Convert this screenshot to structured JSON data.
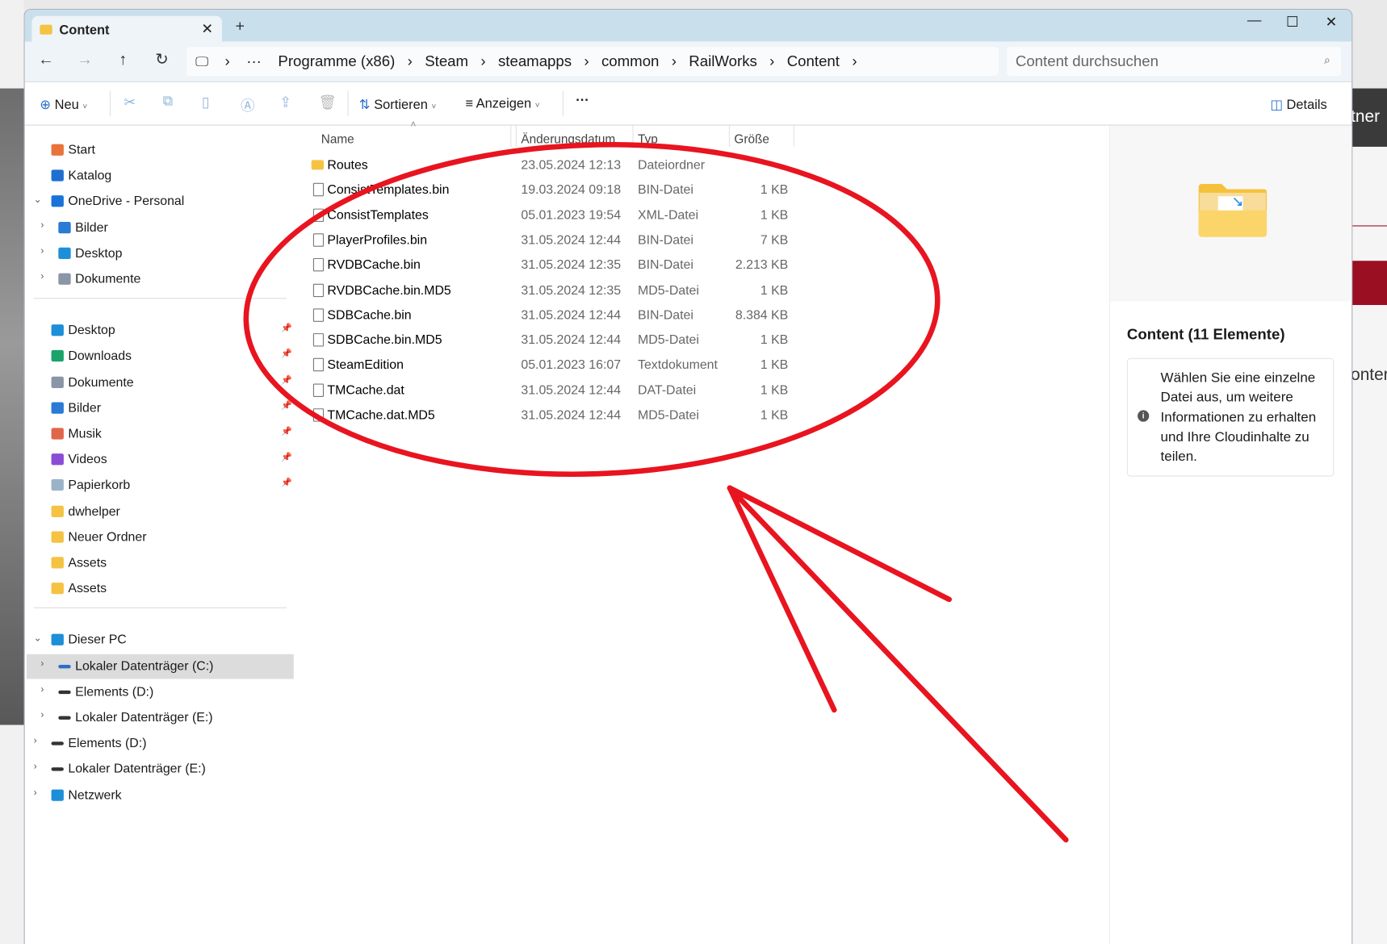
{
  "window": {
    "tab_title": "Content",
    "close_tab": "✕",
    "new_tab": "+",
    "minimize": "—",
    "maximize": "☐",
    "close": "✕"
  },
  "nav": {
    "back": "←",
    "forward": "→",
    "up": "↑",
    "refresh": "↻",
    "pc": "🖵",
    "more": "···",
    "sep": "›",
    "breadcrumbs": [
      "Programme (x86)",
      "Steam",
      "steamapps",
      "common",
      "RailWorks",
      "Content"
    ],
    "search_placeholder": "Content durchsuchen"
  },
  "toolbar": {
    "new": "Neu",
    "sort": "Sortieren",
    "view": "Anzeigen",
    "more": "···",
    "details": "Details"
  },
  "sidebar": {
    "items": [
      {
        "label": "Start",
        "icon": "home-icon",
        "color": "#e8743b",
        "level": 1
      },
      {
        "label": "Katalog",
        "icon": "gallery-icon",
        "color": "#1f6fd1",
        "level": 1
      },
      {
        "label": "OneDrive - Personal",
        "icon": "cloud-icon",
        "color": "#1a73d9",
        "level": 1,
        "chevron": "open"
      },
      {
        "label": "Bilder",
        "icon": "pictures-icon",
        "color": "#2a7ad6",
        "level": 2,
        "chevron": "closed"
      },
      {
        "label": "Desktop",
        "icon": "desktop-icon",
        "color": "#1d8fd8",
        "level": 2,
        "chevron": "closed"
      },
      {
        "label": "Dokumente",
        "icon": "documents-icon",
        "color": "#8a96a6",
        "level": 2,
        "chevron": "closed"
      },
      {
        "sep": true
      },
      {
        "label": "Desktop",
        "icon": "desktop-icon",
        "color": "#1d8fd8",
        "level": 1,
        "pin": true
      },
      {
        "label": "Downloads",
        "icon": "download-icon",
        "color": "#1aa36b",
        "level": 1,
        "pin": true
      },
      {
        "label": "Dokumente",
        "icon": "documents-icon",
        "color": "#8a96a6",
        "level": 1,
        "pin": true
      },
      {
        "label": "Bilder",
        "icon": "pictures-icon",
        "color": "#2a7ad6",
        "level": 1,
        "pin": true
      },
      {
        "label": "Musik",
        "icon": "music-icon",
        "color": "#e0664a",
        "level": 1,
        "pin": true
      },
      {
        "label": "Videos",
        "icon": "videos-icon",
        "color": "#8a4dd6",
        "level": 1,
        "pin": true
      },
      {
        "label": "Papierkorb",
        "icon": "recycle-bin-icon",
        "color": "#9bb3c9",
        "level": 1,
        "pin": true
      },
      {
        "label": "dwhelper",
        "icon": "folder-icon",
        "color": "#f5c242",
        "level": 1
      },
      {
        "label": "Neuer Ordner",
        "icon": "folder-icon",
        "color": "#f5c242",
        "level": 1
      },
      {
        "label": "Assets",
        "icon": "folder-icon",
        "color": "#f5c242",
        "level": 1
      },
      {
        "label": "Assets",
        "icon": "folder-icon",
        "color": "#f5c242",
        "level": 1
      },
      {
        "sep": true
      },
      {
        "label": "Dieser PC",
        "icon": "pc-icon",
        "color": "#1d8fd8",
        "level": 1,
        "chevron": "open"
      },
      {
        "label": "Lokaler Datenträger (C:)",
        "icon": "drive-icon",
        "color": "#2a6fc9",
        "level": 2,
        "chevron": "closed",
        "selected": true
      },
      {
        "label": "Elements (D:)",
        "icon": "drive-icon",
        "color": "#333",
        "level": 2,
        "chevron": "closed"
      },
      {
        "label": "Lokaler Datenträger (E:)",
        "icon": "drive-icon",
        "color": "#333",
        "level": 2,
        "chevron": "closed"
      },
      {
        "label": "Elements (D:)",
        "icon": "drive-icon",
        "color": "#333",
        "level": 1,
        "chevron": "closed"
      },
      {
        "label": "Lokaler Datenträger (E:)",
        "icon": "drive-icon",
        "color": "#333",
        "level": 1,
        "chevron": "closed"
      },
      {
        "label": "Netzwerk",
        "icon": "network-icon",
        "color": "#1d8fd8",
        "level": 1,
        "chevron": "closed"
      }
    ]
  },
  "list": {
    "columns": [
      "Name",
      "Änderungsdatum",
      "Typ",
      "Größe"
    ],
    "rows": [
      {
        "name": "Routes",
        "date": "23.05.2024 12:13",
        "type": "Dateiordner",
        "size": "",
        "folder": true
      },
      {
        "name": "ConsistTemplates.bin",
        "date": "19.03.2024 09:18",
        "type": "BIN-Datei",
        "size": "1 KB"
      },
      {
        "name": "ConsistTemplates",
        "date": "05.01.2023 19:54",
        "type": "XML-Datei",
        "size": "1 KB"
      },
      {
        "name": "PlayerProfiles.bin",
        "date": "31.05.2024 12:44",
        "type": "BIN-Datei",
        "size": "7 KB"
      },
      {
        "name": "RVDBCache.bin",
        "date": "31.05.2024 12:35",
        "type": "BIN-Datei",
        "size": "2.213 KB"
      },
      {
        "name": "RVDBCache.bin.MD5",
        "date": "31.05.2024 12:35",
        "type": "MD5-Datei",
        "size": "1 KB"
      },
      {
        "name": "SDBCache.bin",
        "date": "31.05.2024 12:44",
        "type": "BIN-Datei",
        "size": "8.384 KB"
      },
      {
        "name": "SDBCache.bin.MD5",
        "date": "31.05.2024 12:44",
        "type": "MD5-Datei",
        "size": "1 KB"
      },
      {
        "name": "SteamEdition",
        "date": "05.01.2023 16:07",
        "type": "Textdokument",
        "size": "1 KB"
      },
      {
        "name": "TMCache.dat",
        "date": "31.05.2024 12:44",
        "type": "DAT-Datei",
        "size": "1 KB"
      },
      {
        "name": "TMCache.dat.MD5",
        "date": "31.05.2024 12:44",
        "type": "MD5-Datei",
        "size": "1 KB"
      }
    ]
  },
  "details": {
    "title": "Content (11 Elemente)",
    "info": "Wählen Sie eine einzelne Datei aus, um weitere Informationen zu erhalten und Ihre Cloudinhalte zu teilen."
  },
  "background": {
    "right_header_fragment": "tner",
    "right_text_fragment": "onter"
  },
  "annotation_color": "#e8141f"
}
